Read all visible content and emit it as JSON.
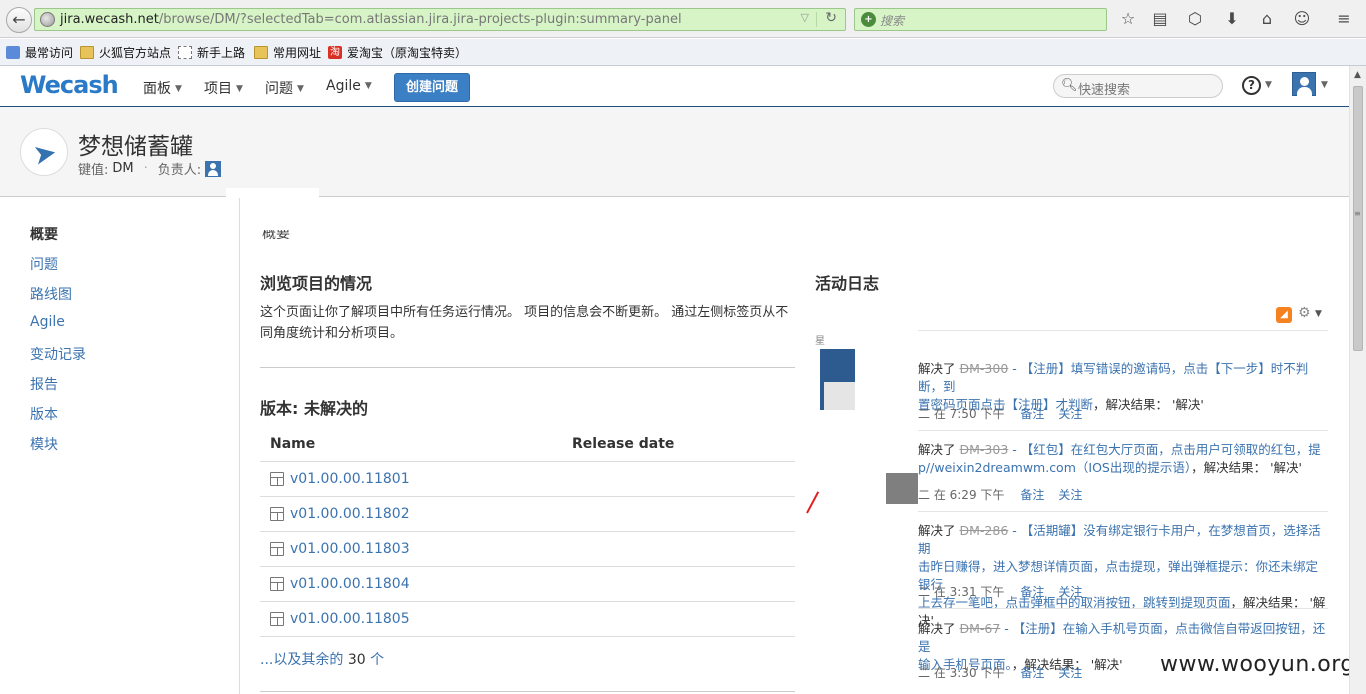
{
  "browser": {
    "url_host": "jira.wecash.net",
    "url_path": "/browse/DM/?selectedTab=com.atlassian.jira.jira-projects-plugin:summary-panel",
    "search_placeholder": "搜索"
  },
  "bookmarks": [
    {
      "label": "最常访问",
      "icon": "blue-square-icon"
    },
    {
      "label": "火狐官方站点",
      "icon": "folder-icon"
    },
    {
      "label": "新手上路",
      "icon": "dashed-box-icon"
    },
    {
      "label": "常用网址",
      "icon": "folder-icon"
    },
    {
      "label": "爱淘宝（原淘宝特卖）",
      "icon": "taobao-icon",
      "badge": "淘"
    }
  ],
  "header": {
    "logo": "Wecash",
    "nav": [
      "面板",
      "项目",
      "问题",
      "Agile"
    ],
    "create_label": "创建问题",
    "quick_search_placeholder": "快速搜索"
  },
  "project": {
    "name": "梦想储蓄罐",
    "key_label": "键值:",
    "key": "DM",
    "lead_label": "负责人:"
  },
  "sidebar": {
    "items": [
      "概要",
      "问题",
      "路线图",
      "Agile",
      "变动记录",
      "报告",
      "版本",
      "模块"
    ],
    "active_index": 0
  },
  "main": {
    "cut_heading": "概要",
    "section_title": "浏览项目的情况",
    "intro": "这个页面让你了解项目中所有任务运行情况。 项目的信息会不断更新。 通过左侧标签页从不同角度统计和分析项目。",
    "versions_title": "版本: 未解决的",
    "col_name": "Name",
    "col_release": "Release date",
    "versions": [
      "v01.00.00.11801",
      "v01.00.00.11802",
      "v01.00.00.11803",
      "v01.00.00.11804",
      "v01.00.00.11805"
    ],
    "more_prefix": "...以及其余的",
    "more_count": "30",
    "more_suffix": "个"
  },
  "activity": {
    "title": "活动日志",
    "cut_label": "星",
    "entries": [
      {
        "action": "解决了",
        "key": "DM-300",
        "summary_l1": " - 【注册】填写错误的邀请码，点击【下一步】时不判断，到",
        "summary_l2": "置密码页面点击【注册】才判断",
        "result": "，解决结果： '解决'",
        "time": "二 在 7:50 下午",
        "comment": "备注",
        "watch": "关注"
      },
      {
        "action": "解决了",
        "key": "DM-303",
        "summary_l1": " - 【红包】在红包大厅页面，点击用户可领取的红包，提",
        "summary_l2": "p//weixin2dreamwm.com（IOS出现的提示语）",
        "result": "，解决结果： '解决'",
        "time": "二 在 6:29 下午",
        "comment": "备注",
        "watch": "关注"
      },
      {
        "action": "解决了",
        "key": "DM-286",
        "summary_l1": " - 【活期罐】没有绑定银行卡用户，在梦想首页，选择活期",
        "summary_l2": "击昨日赚得，进入梦想详情页面，点击提现，弹出弹框提示：你还未绑定银行",
        "summary_l3": "上去存一笔吧，点击弹框中的取消按钮，跳转到提现页面",
        "result": "，解决结果： '解决'",
        "time": "二 在 3:31 下午",
        "comment": "备注",
        "watch": "关注"
      },
      {
        "action": "解决了",
        "key": "DM-67",
        "summary_l1": " - 【注册】在输入手机号页面，点击微信自带返回按钮，还是",
        "summary_l2": "输入手机号页面。",
        "result": "，解决结果： '解决'",
        "time": "二 在 3:30 下午",
        "comment": "备注",
        "watch": "关注"
      }
    ]
  },
  "watermark": "www.wooyun.org",
  "colors": {
    "link": "#3b73af",
    "primary_button": "#3b7fc4",
    "urlbar": "#d7f4c7"
  }
}
